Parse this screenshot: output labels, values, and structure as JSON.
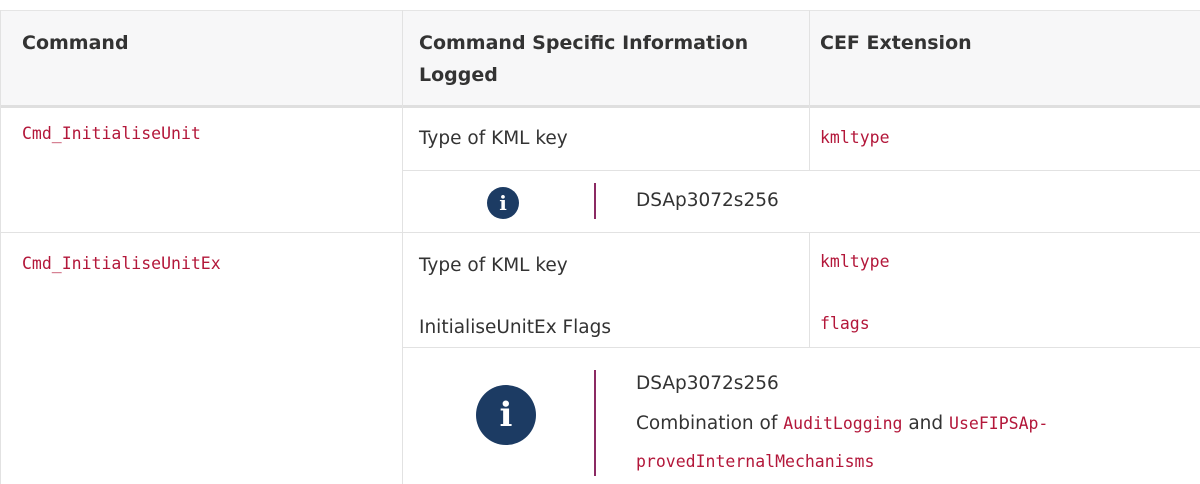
{
  "header": {
    "col1": "Command",
    "col2_line1": "Command Specific Information",
    "col2_line2": "Logged",
    "col3": "CEF Extension"
  },
  "rows": [
    {
      "command": "Cmd_InitialiseUnit",
      "items": [
        {
          "info": "Type of KML key",
          "extension": "kmltype"
        }
      ],
      "note": {
        "icon": "info-icon",
        "line1": "DSAp3072s256"
      }
    },
    {
      "command": "Cmd_InitialiseUnitEx",
      "items": [
        {
          "info": "Type of KML key",
          "extension": "kmltype"
        },
        {
          "info": "InitialiseUnitEx Flags",
          "extension": "flags"
        }
      ],
      "note": {
        "icon": "info-icon",
        "line1": "DSAp3072s256",
        "line2_prefix": "Combination of ",
        "line2_code1": "AuditLogging",
        "line2_mid": " and ",
        "line2_code2": "UseFIPSAp-",
        "line3_code": "provedInternalMechanisms"
      }
    }
  ],
  "colors": {
    "code": "#b3173a",
    "icon_bg": "#1c3b63",
    "note_bar": "#8b2a63",
    "header_bg": "#f7f7f8"
  }
}
